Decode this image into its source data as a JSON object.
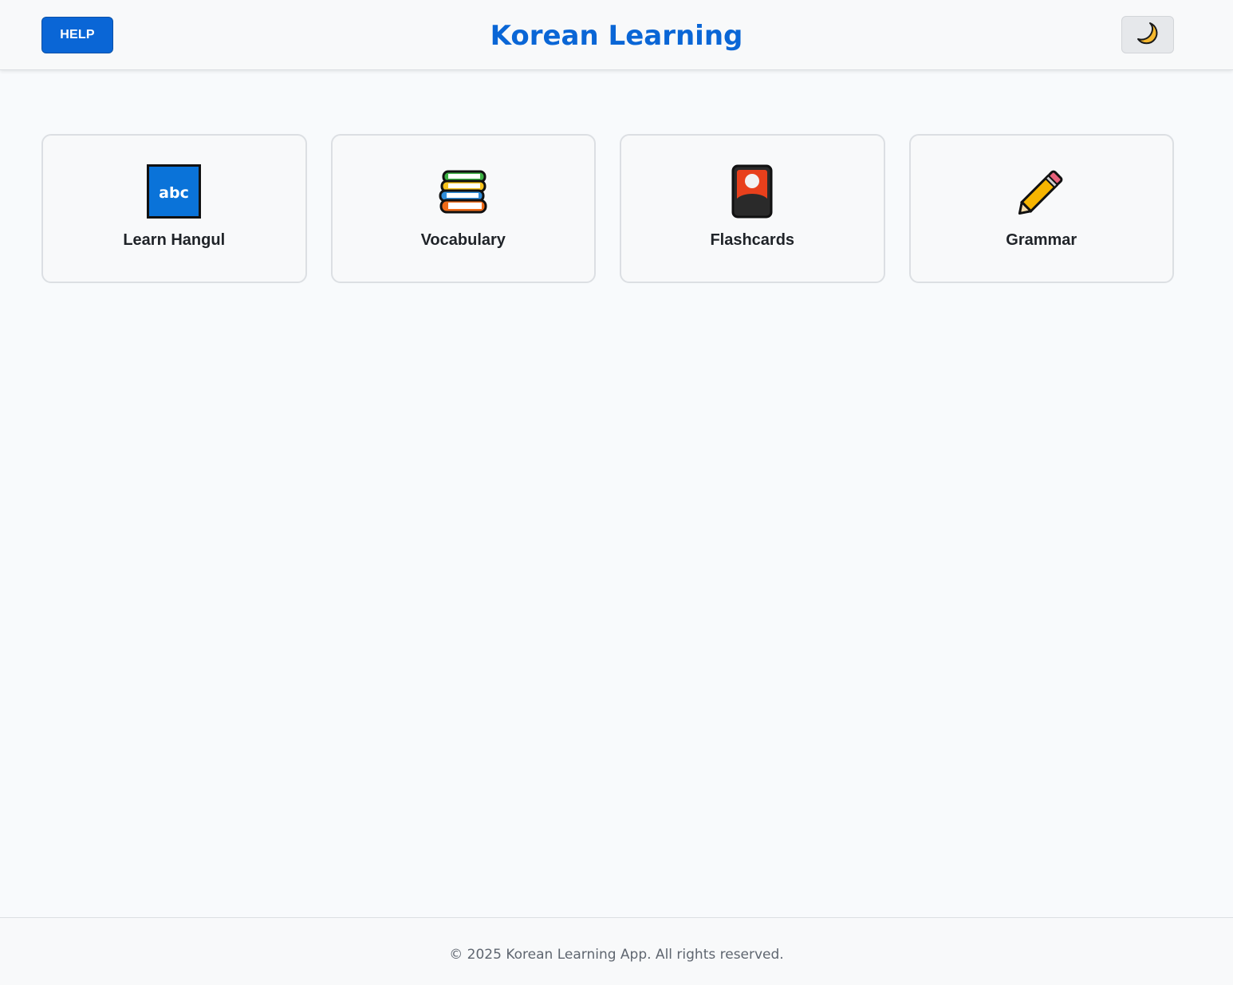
{
  "header": {
    "help_label": "HELP",
    "title": "Korean Learning",
    "theme_toggle_icon": "moon-icon"
  },
  "menu": {
    "items": [
      {
        "label": "Learn Hangul",
        "icon": "abc-icon",
        "icon_text": "abc"
      },
      {
        "label": "Vocabulary",
        "icon": "books-icon"
      },
      {
        "label": "Flashcards",
        "icon": "flashcard-icon"
      },
      {
        "label": "Grammar",
        "icon": "pencil-icon"
      }
    ]
  },
  "footer": {
    "copyright": "© 2025 Korean Learning App. All rights reserved."
  },
  "colors": {
    "accent": "#0a66d6",
    "background": "#f8fafc",
    "card_border": "#dcdfe3",
    "text": "#1f2328"
  }
}
